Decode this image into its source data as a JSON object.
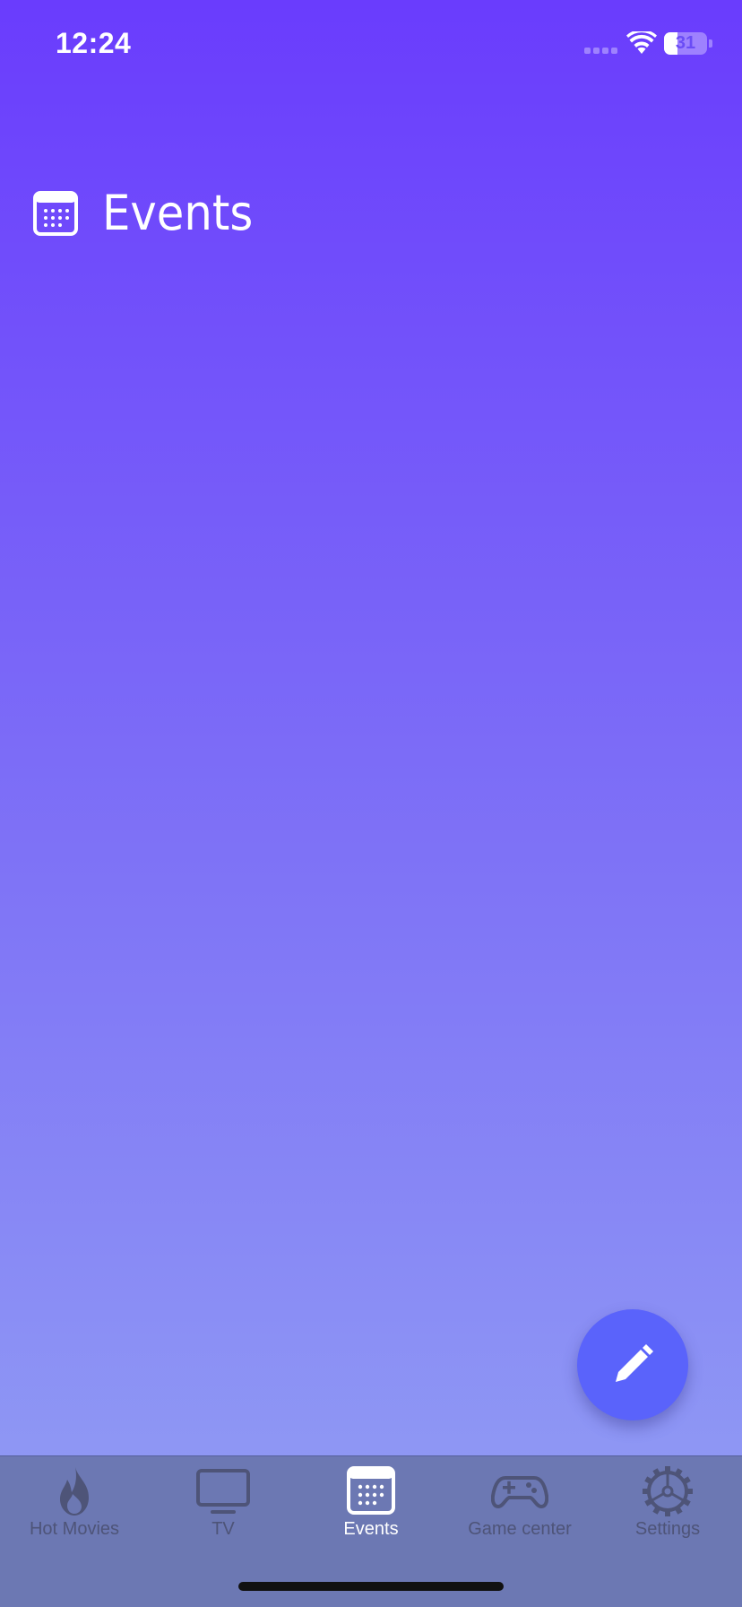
{
  "status_bar": {
    "time": "12:24",
    "battery": 31
  },
  "header": {
    "title": "Events",
    "icon": "calendar-icon"
  },
  "fab": {
    "icon": "pencil-icon",
    "color": "#5a63fb"
  },
  "tabs": [
    {
      "label": "Hot Movies",
      "icon": "flame-icon",
      "active": false
    },
    {
      "label": "TV",
      "icon": "tv-icon",
      "active": false
    },
    {
      "label": "Events",
      "icon": "calendar-icon",
      "active": true
    },
    {
      "label": "Game center",
      "icon": "gamepad-icon",
      "active": false
    },
    {
      "label": "Settings",
      "icon": "gear-icon",
      "active": false
    }
  ],
  "colors": {
    "gradient_top": "#6a3cfd",
    "gradient_bottom": "#92a0f4",
    "tab_bar": "#6c78b3",
    "tab_inactive": "#4e5478",
    "tab_active": "#ffffff"
  }
}
